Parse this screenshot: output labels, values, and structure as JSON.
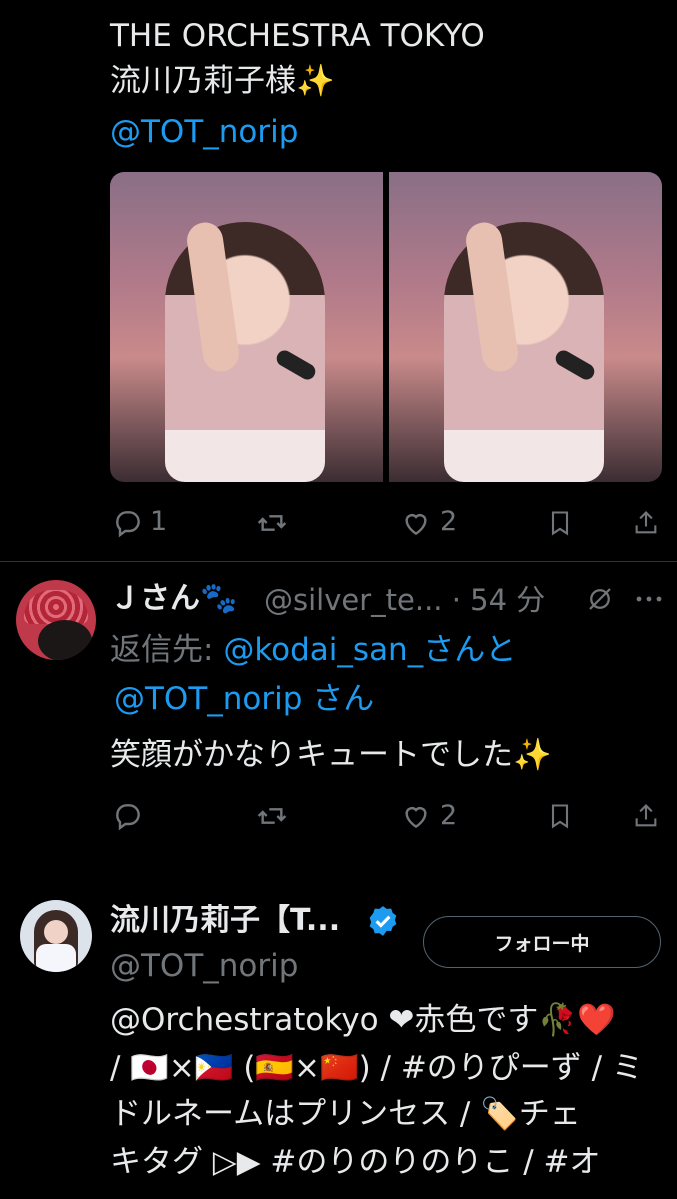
{
  "tweet1": {
    "line1": "THE ORCHESTRA TOKYO",
    "line2": "流川乃莉子様✨",
    "mention": "@TOT_norip",
    "reply_count": "1",
    "like_count": "2"
  },
  "reply": {
    "display_name": "Ｊさん🐾",
    "handle_time": "@silver_te... · 54 分",
    "reply_to_prefix": "返信先: ",
    "reply_to_mention1": "@kodai_san_さんと",
    "reply_to_mention2": "@TOT_norip さん",
    "text": "笑顔がかなりキュートでした✨",
    "like_count": "2"
  },
  "profile": {
    "display_name": "流川乃莉子【T...",
    "handle": "@TOT_norip",
    "follow_label": "フォロー中",
    "bio_line1": "@Orchestratokyo ❤赤色です🥀❤️",
    "bio_line2": "/ 🇯🇵×🇵🇭 (🇪🇸×🇨🇳) / #のりぴーず / ミ",
    "bio_line3": "ドルネームはプリンセス / 🏷️チェ",
    "bio_line4": "キタグ ▷▶ #のりのりのりこ / #オ"
  },
  "icons": {
    "reply": "reply-icon",
    "retweet": "retweet-icon",
    "like": "heart-icon",
    "bookmark": "bookmark-icon",
    "share": "share-icon",
    "more": "more-icon",
    "grok": "grok-icon",
    "verified": "verified-badge-icon"
  },
  "colors": {
    "background": "#000000",
    "text": "#e7e9ea",
    "muted": "#71767b",
    "link": "#1d9bf0"
  }
}
